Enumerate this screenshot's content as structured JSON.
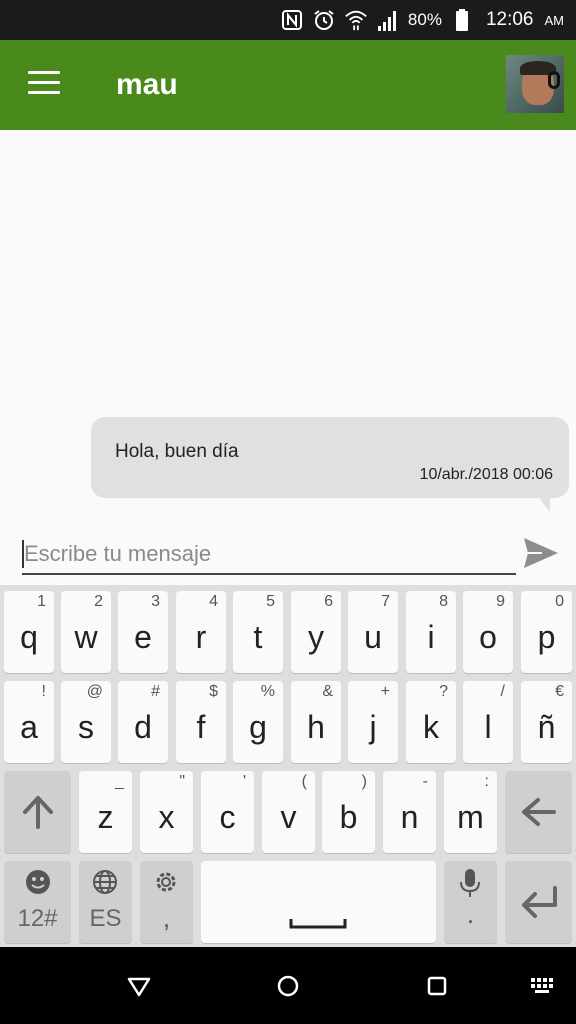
{
  "status_bar": {
    "battery": "80%",
    "time": "12:06",
    "ampm": "AM",
    "icons": [
      "nfc-icon",
      "alarm-icon",
      "wifi-icon",
      "signal-icon",
      "battery-icon"
    ]
  },
  "app_bar": {
    "title": "mau",
    "menu_icon": "hamburger-menu-icon",
    "avatar": "contact-avatar"
  },
  "messages": [
    {
      "text": "Hola, buen día",
      "timestamp": "10/abr./2018 00:06"
    }
  ],
  "composer": {
    "placeholder": "Escribe tu mensaje",
    "value": "",
    "send_icon": "send-icon"
  },
  "keyboard": {
    "row1": [
      {
        "main": "q",
        "sup": "1"
      },
      {
        "main": "w",
        "sup": "2"
      },
      {
        "main": "e",
        "sup": "3"
      },
      {
        "main": "r",
        "sup": "4"
      },
      {
        "main": "t",
        "sup": "5"
      },
      {
        "main": "y",
        "sup": "6"
      },
      {
        "main": "u",
        "sup": "7"
      },
      {
        "main": "i",
        "sup": "8"
      },
      {
        "main": "o",
        "sup": "9"
      },
      {
        "main": "p",
        "sup": "0"
      }
    ],
    "row2": [
      {
        "main": "a",
        "sup": "!"
      },
      {
        "main": "s",
        "sup": "@"
      },
      {
        "main": "d",
        "sup": "#"
      },
      {
        "main": "f",
        "sup": "$"
      },
      {
        "main": "g",
        "sup": "%"
      },
      {
        "main": "h",
        "sup": "&"
      },
      {
        "main": "j",
        "sup": "+"
      },
      {
        "main": "k",
        "sup": "?"
      },
      {
        "main": "l",
        "sup": "/"
      },
      {
        "main": "ñ",
        "sup": "€"
      }
    ],
    "row3": [
      {
        "main": "z",
        "sup": "_"
      },
      {
        "main": "x",
        "sup": "\""
      },
      {
        "main": "c",
        "sup": "'"
      },
      {
        "main": "v",
        "sup": "("
      },
      {
        "main": "b",
        "sup": ")"
      },
      {
        "main": "n",
        "sup": "-"
      },
      {
        "main": "m",
        "sup": ":"
      }
    ],
    "emoji_label": "12#",
    "lang_label": "ES",
    "settings_label": ",",
    "mic_label": "."
  },
  "nav_bar": {
    "icons": [
      "back-triangle-icon",
      "home-circle-icon",
      "recents-square-icon",
      "keyboard-icon"
    ]
  },
  "colors": {
    "app_bar": "#4a8a1c",
    "status_bar": "#1b1b1b",
    "bubble": "#e0e0e0",
    "nav_bar": "#000000"
  }
}
